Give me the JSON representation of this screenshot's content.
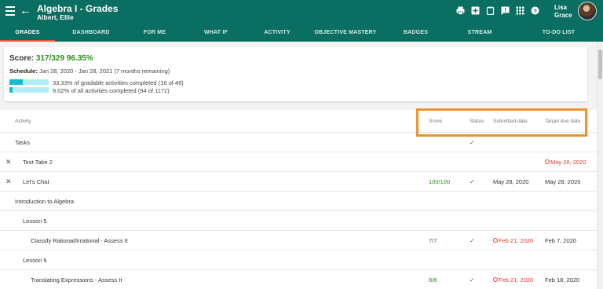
{
  "header": {
    "back_icon": "←",
    "title": "Algebra I - Grades",
    "subtitle": "Albert, Ellie",
    "user_first": "Lisa",
    "user_last": "Grace",
    "icons": [
      "print-icon",
      "add-box-icon",
      "clipboard-icon",
      "feedback-icon",
      "apps-grid-icon",
      "help-icon"
    ]
  },
  "tabs": [
    {
      "label": "GRADES",
      "active": true
    },
    {
      "label": "DASHBOARD"
    },
    {
      "label": "FOR ME"
    },
    {
      "label": "WHAT IF"
    },
    {
      "label": "ACTIVITY"
    },
    {
      "label": "OBJECTIVE MASTERY"
    },
    {
      "label": "BADGES"
    },
    {
      "label": "STREAM"
    },
    {
      "label": "TO-DO LIST"
    }
  ],
  "summary": {
    "score_label": "Score:",
    "score_value": "317/329 96.35%",
    "schedule_label": "Schedule:",
    "schedule_value": "Jan 28, 2020 - Jan 28, 2021 (7 months remaining)",
    "progress": [
      {
        "fraction": 0.3333,
        "label": "33.33% of gradable activities completed (16 of 48)"
      },
      {
        "fraction": 0.0802,
        "label": "8.02% of all activities completed (94 of 1172)"
      }
    ]
  },
  "table": {
    "columns": {
      "activity": "Activity",
      "score": "Score",
      "status": "Status",
      "submitted": "Submitted date",
      "due": "Target due date"
    },
    "rows": [
      {
        "activity": "Tasks",
        "indent": 0,
        "score": "",
        "status": "✓",
        "submitted": "",
        "submitted_overdue": false,
        "due": "",
        "due_overdue": false,
        "removable": false
      },
      {
        "activity": "Test Take 2",
        "indent": 1,
        "score": "",
        "status": "",
        "submitted": "",
        "submitted_overdue": false,
        "due": "May 28, 2020",
        "due_overdue": true,
        "removable": true
      },
      {
        "activity": "Let's Chat",
        "indent": 1,
        "score": "100/100",
        "status": "✓",
        "submitted": "May 28, 2020",
        "submitted_overdue": false,
        "due": "May 28, 2020",
        "due_overdue": false,
        "removable": true
      },
      {
        "activity": "Introduction to Algebra",
        "indent": 0,
        "score": "",
        "status": "",
        "submitted": "",
        "submitted_overdue": false,
        "due": "",
        "due_overdue": false,
        "removable": false
      },
      {
        "activity": "Lesson 5",
        "indent": 1,
        "score": "",
        "status": "",
        "submitted": "",
        "submitted_overdue": false,
        "due": "",
        "due_overdue": false,
        "removable": false
      },
      {
        "activity": "Classify Rational/Irrational - Assess It",
        "indent": 2,
        "score": "7/7",
        "status": "✓",
        "submitted": "Feb 21, 2020",
        "submitted_overdue": true,
        "due": "Feb 7, 2020",
        "due_overdue": false,
        "removable": false
      },
      {
        "activity": "Lesson 9",
        "indent": 1,
        "score": "",
        "status": "",
        "submitted": "",
        "submitted_overdue": false,
        "due": "",
        "due_overdue": false,
        "removable": false
      },
      {
        "activity": "Translating Expressions - Assess It",
        "indent": 2,
        "score": "8/8",
        "status": "✓",
        "submitted": "Feb 21, 2020",
        "submitted_overdue": true,
        "due": "Feb 18, 2020",
        "due_overdue": false,
        "removable": false
      }
    ],
    "remove_icon": "✕"
  },
  "colors": {
    "appbar": "#0b6e62",
    "accent_tab": "#e65a3a",
    "score_green": "#2e8b1e",
    "overdue_red": "#e53935",
    "highlight": "#f0922b",
    "progress_fill": "#17b8d4",
    "progress_track": "#b4ecf5"
  }
}
